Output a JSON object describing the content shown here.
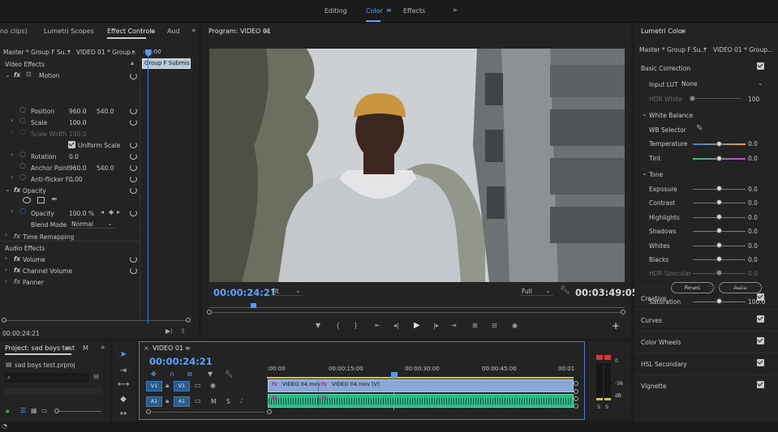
{
  "workspace": {
    "tabs": [
      "Editing",
      "Color",
      "Effects"
    ],
    "active": "Color",
    "more": "»"
  },
  "left_tabs": {
    "t0": "no clips)",
    "t1": "Lumetri Scopes",
    "t2": "Effect Controls",
    "t3": "Aud",
    "more": "»"
  },
  "effect_controls": {
    "master": "Master * Group F Su...",
    "clip": "VIDEO 01 * Group...",
    "ruler_time": ":00:00",
    "clip_bar": "Group F Submissi",
    "video_effects": "Video Effects",
    "motion": "Motion",
    "position_label": "Position",
    "position_x": "960.0",
    "position_y": "540.0",
    "scale_label": "Scale",
    "scale_value": "100.0",
    "scale_width_label": "Scale Width",
    "scale_width_value": "100.0",
    "uniform_scale": "Uniform Scale",
    "rotation_label": "Rotation",
    "rotation_value": "0.0",
    "anchor_label": "Anchor Point",
    "anchor_x": "960.0",
    "anchor_y": "540.0",
    "antiflicker_label": "Anti-flicker F...",
    "antiflicker_value": "0.00",
    "opacity": "Opacity",
    "opacity_label": "Opacity",
    "opacity_value": "100.0 %",
    "blend_label": "Blend Mode",
    "blend_value": "Normal",
    "time_remap": "Time Remapping",
    "audio_effects": "Audio Effects",
    "volume": "Volume",
    "channel_volume": "Channel Volume",
    "panner": "Panner",
    "fx": "fx",
    "timecode": "00:00:24:21"
  },
  "program": {
    "title": "Program: VIDEO 01",
    "timecode": "00:00:24:21",
    "fit": "Fit",
    "quality": "Full",
    "duration": "00:03:49:05",
    "colors": {
      "sky": "#d6d8da",
      "building": "#6b7073",
      "hoodie": "#c4c7cc",
      "skin": "#3b2720",
      "beanie": "#c8953c"
    }
  },
  "project": {
    "title": "Project: sad boys test",
    "tab2": "M",
    "filename": "sad boys test.prproj"
  },
  "timeline": {
    "title": "VIDEO 01",
    "timecode": "00:00:24:21",
    "ruler": [
      ":00:00",
      "00:00:15:00",
      "00:00:30:00",
      "00:00:45:00",
      "00:01"
    ],
    "v1_label": "V1",
    "a1_label": "A1",
    "clip1": "VIDEO 04.mov",
    "clip2": "VIDEO 04.mov [V]",
    "meter_labels": [
      "0",
      "-36",
      "dB"
    ],
    "solo": "S"
  },
  "lumetri": {
    "title": "Lumetri Color",
    "master": "Master * Group F Su...",
    "clip": "VIDEO 01 * Group...",
    "basic_correction": "Basic Correction",
    "input_lut_label": "Input LUT",
    "input_lut_value": "None",
    "hdr_white_label": "HDR White",
    "hdr_white_value": "100",
    "white_balance": "White Balance",
    "wb_selector": "WB Selector",
    "temperature_label": "Temperature",
    "temperature_value": "0.0",
    "tint_label": "Tint",
    "tint_value": "0.0",
    "tone": "Tone",
    "exposure_label": "Exposure",
    "exposure_value": "0.0",
    "contrast_label": "Contrast",
    "contrast_value": "0.0",
    "highlights_label": "Highlights",
    "highlights_value": "0.0",
    "shadows_label": "Shadows",
    "shadows_value": "0.0",
    "whites_label": "Whites",
    "whites_value": "0.0",
    "blacks_label": "Blacks",
    "blacks_value": "0.0",
    "hdr_specular_label": "HDR Specular",
    "hdr_specular_value": "0.0",
    "reset_label": "Reset",
    "auto_label": "Auto",
    "saturation_label": "Saturation",
    "saturation_value": "100.0",
    "sections": [
      "Creative",
      "Curves",
      "Color Wheels",
      "HSL Secondary",
      "Vignette"
    ]
  }
}
